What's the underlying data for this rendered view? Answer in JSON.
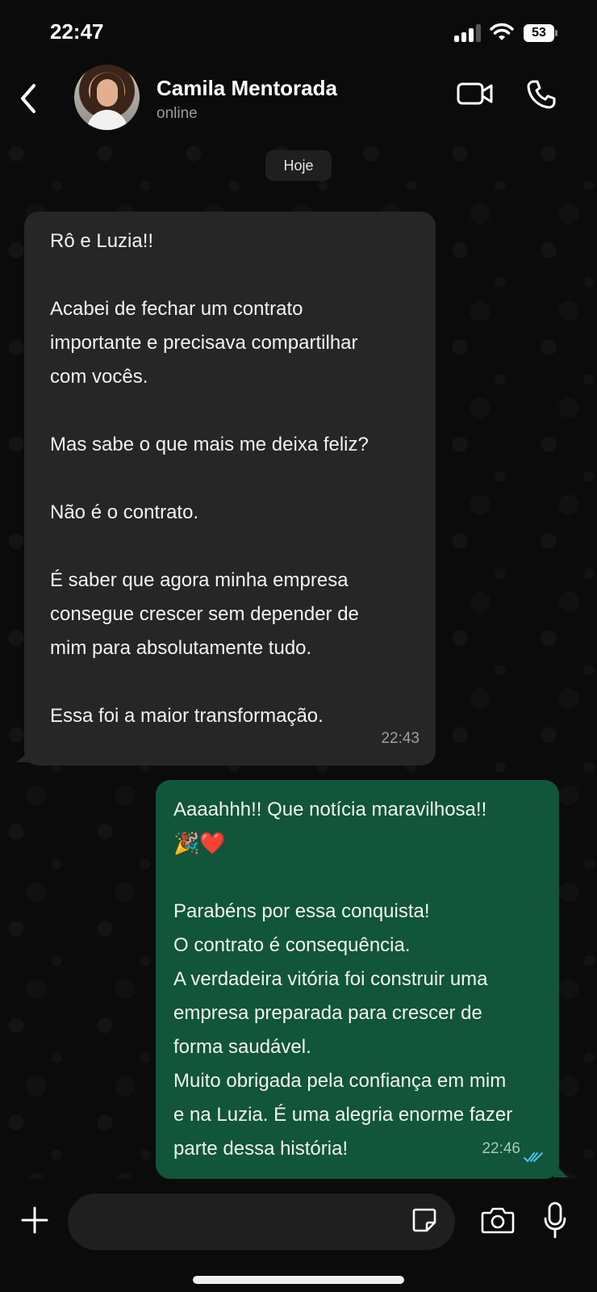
{
  "status_bar": {
    "time": "22:47",
    "battery": "53",
    "icons": [
      "signal-icon",
      "wifi-icon",
      "battery-icon"
    ]
  },
  "header": {
    "contact_name": "Camila Mentorada",
    "status": "online",
    "icons": [
      "back-icon",
      "avatar",
      "video-call-icon",
      "phone-call-icon"
    ]
  },
  "chat": {
    "date_label": "Hoje",
    "messages": [
      {
        "direction": "incoming",
        "lines": [
          "Rô e Luzia!!",
          "",
          "Acabei de fechar um contrato",
          "importante e precisava compartilhar",
          "com vocês.",
          "",
          "Mas sabe o que mais me deixa feliz?",
          "",
          "Não é o contrato.",
          "",
          "É saber que agora minha empresa",
          "consegue crescer sem depender de",
          "mim para absolutamente tudo.",
          "",
          "Essa foi a maior transformação."
        ],
        "time": "22:43"
      },
      {
        "direction": "outgoing",
        "lines": [
          "Aaaahhh!! Que notícia maravilhosa!!",
          "🎉❤️",
          "",
          "Parabéns por essa conquista!",
          "O contrato é consequência.",
          "A verdadeira vitória foi construir uma",
          "empresa preparada para crescer de",
          "forma saudável.",
          "Muito obrigada pela confiança em mim",
          "e na Luzia. É uma alegria enorme fazer",
          "parte dessa história!"
        ],
        "time": "22:46",
        "read_status": "read"
      }
    ]
  },
  "input_bar": {
    "placeholder": "",
    "icons": [
      "plus-icon",
      "sticker-icon",
      "camera-icon",
      "microphone-icon"
    ]
  },
  "colors": {
    "background": "#0b0b0b",
    "incoming_bubble": "#262626",
    "outgoing_bubble": "#11553a",
    "read_ticks": "#53bdeb"
  }
}
